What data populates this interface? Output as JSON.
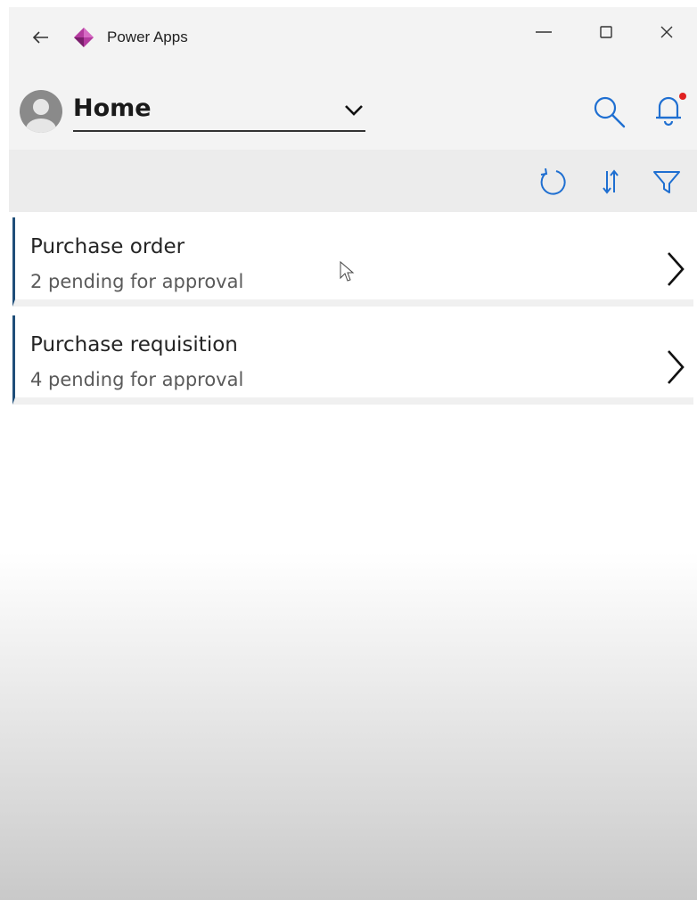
{
  "window": {
    "app_title": "Power Apps",
    "logo_color": "#9b2c8c"
  },
  "header": {
    "page_select_value": "Home",
    "notification_dot_color": "#e02020",
    "accent": "#1f6fd1"
  },
  "toolbar": {
    "icons": [
      "refresh-icon",
      "sort-icon",
      "filter-icon"
    ]
  },
  "list": {
    "items": [
      {
        "title": "Purchase order",
        "subtitle": "2 pending for approval"
      },
      {
        "title": "Purchase requisition",
        "subtitle": "4 pending for approval"
      }
    ]
  }
}
